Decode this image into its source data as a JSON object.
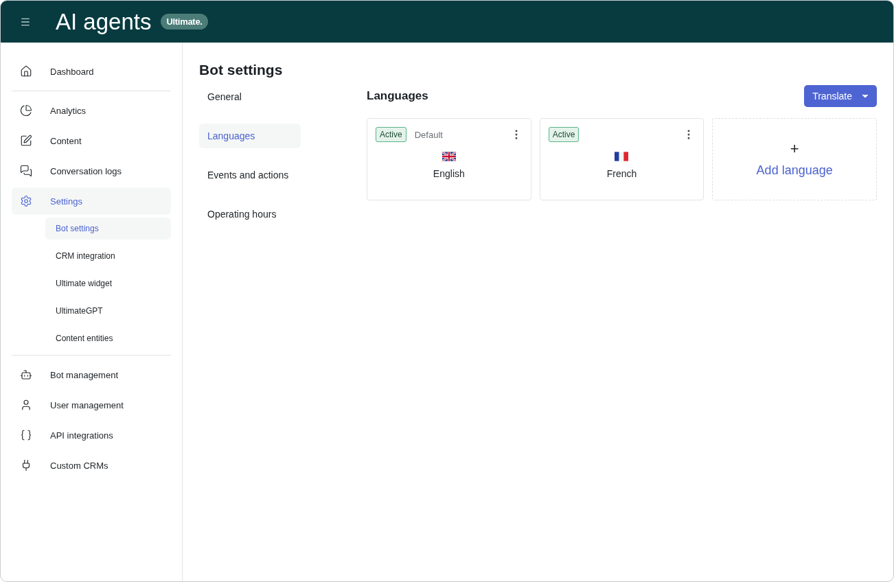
{
  "header": {
    "title": "AI agents",
    "badge": "Ultimate."
  },
  "sidebar": {
    "sections": [
      [
        {
          "label": "Dashboard",
          "selected": false
        }
      ],
      [
        {
          "label": "Analytics",
          "selected": false
        },
        {
          "label": "Content",
          "selected": false
        },
        {
          "label": "Conversation logs",
          "selected": false
        },
        {
          "label": "Settings",
          "selected": true,
          "children": [
            {
              "label": "Bot settings",
              "selected": true
            },
            {
              "label": "CRM integration",
              "selected": false
            },
            {
              "label": "Ultimate widget",
              "selected": false
            },
            {
              "label": "UltimateGPT",
              "selected": false
            },
            {
              "label": "Content entities",
              "selected": false
            }
          ]
        }
      ],
      [
        {
          "label": "Bot management",
          "selected": false
        },
        {
          "label": "User management",
          "selected": false
        },
        {
          "label": "API integrations",
          "selected": false
        },
        {
          "label": "Custom CRMs",
          "selected": false
        }
      ]
    ]
  },
  "page": {
    "title": "Bot settings",
    "tabs": [
      {
        "label": "General",
        "selected": false
      },
      {
        "label": "Languages",
        "selected": true
      },
      {
        "label": "Events and actions",
        "selected": false
      },
      {
        "label": "Operating hours",
        "selected": false
      }
    ]
  },
  "languages": {
    "title": "Languages",
    "action": "Translate",
    "cards": [
      {
        "status": "Active",
        "note": "Default",
        "name": "English"
      },
      {
        "status": "Active",
        "name": "French"
      }
    ],
    "add": {
      "symbol": "+",
      "label": "Add language"
    }
  }
}
